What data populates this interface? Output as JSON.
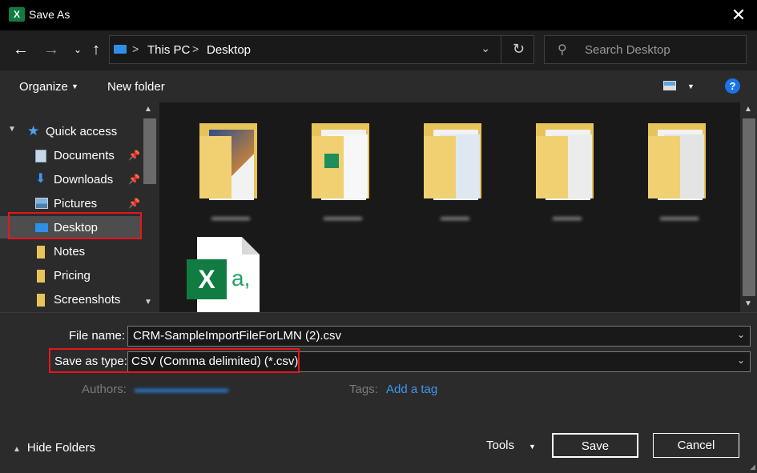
{
  "window": {
    "app_icon_letter": "X",
    "title": "Save As",
    "close_glyph": "✕"
  },
  "address": {
    "breadcrumb": [
      "This PC",
      "Desktop"
    ],
    "separator": ">",
    "search_placeholder": "Search Desktop"
  },
  "toolbar": {
    "organize_label": "Organize",
    "new_folder_label": "New folder",
    "help_label": "?"
  },
  "sidebar": {
    "quick_access_label": "Quick access",
    "items": [
      {
        "label": "Documents",
        "icon": "documents-icon",
        "pinned": true
      },
      {
        "label": "Downloads",
        "icon": "downloads-icon",
        "pinned": true
      },
      {
        "label": "Pictures",
        "icon": "pictures-icon",
        "pinned": true
      },
      {
        "label": "Desktop",
        "icon": "desktop-icon",
        "pinned": false,
        "selected": true
      },
      {
        "label": "Notes",
        "icon": "folder-icon",
        "pinned": false
      },
      {
        "label": "Pricing",
        "icon": "folder-icon",
        "pinned": false
      },
      {
        "label": "Screenshots",
        "icon": "folder-icon",
        "pinned": false
      }
    ]
  },
  "files": {
    "folders": [
      {
        "icon": "folder-icon"
      },
      {
        "icon": "folder-icon"
      },
      {
        "icon": "folder-icon"
      },
      {
        "icon": "folder-icon"
      },
      {
        "icon": "folder-icon"
      }
    ],
    "excel_file": {
      "icon": "excel-csv-icon",
      "glyph_x": "X",
      "glyph_a": "a,"
    }
  },
  "form": {
    "file_name_label": "File name:",
    "file_name_value": "CRM-SampleImportFileForLMN (2).csv",
    "save_type_label": "Save as type:",
    "save_type_value": "CSV (Comma delimited) (*.csv)",
    "authors_label": "Authors:",
    "tags_label": "Tags:",
    "add_tag_label": "Add a tag"
  },
  "footer": {
    "hide_folders_label": "Hide Folders",
    "tools_label": "Tools",
    "save_label": "Save",
    "cancel_label": "Cancel"
  },
  "colors": {
    "highlight": "#e8151b",
    "accent": "#3c98f0",
    "excel_green": "#107c41"
  }
}
